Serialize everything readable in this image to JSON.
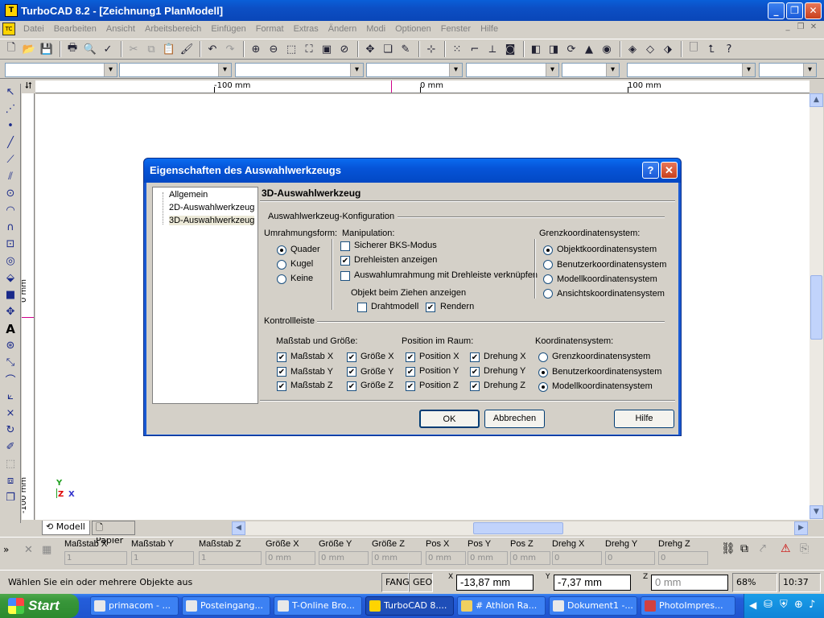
{
  "app": {
    "title": "TurboCAD 8.2 - [Zeichnung1 PlanModell]",
    "icon": "turbocad-icon"
  },
  "menu": [
    "Datei",
    "Bearbeiten",
    "Ansicht",
    "Arbeitsbereich",
    "Einfügen",
    "Format",
    "Extras",
    "Ändern",
    "Modi",
    "Optionen",
    "Fenster",
    "Hilfe"
  ],
  "rulers": {
    "top": [
      "-100 mm",
      "0 mm",
      "100 mm"
    ],
    "left": [
      "0 mm",
      "-100 mm"
    ]
  },
  "canvas_axis": {
    "y": "Y",
    "z": "Z",
    "x": "X"
  },
  "tabs": [
    "Modell",
    "Papier"
  ],
  "controlbar": {
    "fields": [
      {
        "label": "Maßstab X",
        "value": "1"
      },
      {
        "label": "Maßstab Y",
        "value": "1"
      },
      {
        "label": "Maßstab Z",
        "value": "1"
      },
      {
        "label": "Größe X",
        "value": "0 mm"
      },
      {
        "label": "Größe Y",
        "value": "0 mm"
      },
      {
        "label": "Größe Z",
        "value": "0 mm"
      },
      {
        "label": "Pos X",
        "value": "0 mm"
      },
      {
        "label": "Pos Y",
        "value": "0 mm"
      },
      {
        "label": "Pos Z",
        "value": "0 mm"
      },
      {
        "label": "Drehg X",
        "value": "0"
      },
      {
        "label": "Drehg Y",
        "value": "0"
      },
      {
        "label": "Drehg Z",
        "value": "0"
      }
    ]
  },
  "status": {
    "message": "Wählen Sie ein oder mehrere Objekte aus",
    "fang": "FANG",
    "geo": "GEO",
    "x_label": "X",
    "x": "-13,87 mm",
    "y_label": "Y",
    "y": "-7,37 mm",
    "z_label": "Z",
    "z": "0 mm",
    "zoom": "68%",
    "time": "10:37"
  },
  "taskbar": {
    "start": "Start",
    "tasks": [
      "primacom - ...",
      "Posteingang...",
      "T-Online Bro...",
      "TurboCAD 8....",
      "# Athlon Ra...",
      "Dokument1 -...",
      "PhotoImpres..."
    ]
  },
  "dialog": {
    "title": "Eigenschaften des Auswahlwerkzeugs",
    "tree": [
      "Allgemein",
      "2D-Auswahlwerkzeug",
      "3D-Auswahlwerkzeug"
    ],
    "header": "3D-Auswahlwerkzeug",
    "config_label": "Auswahlwerkzeug-Konfiguration",
    "umrahmung": {
      "label": "Umrahmungsform:",
      "options": [
        {
          "label": "Quader",
          "checked": true
        },
        {
          "label": "Kugel",
          "checked": false
        },
        {
          "label": "Keine",
          "checked": false
        }
      ]
    },
    "manipulation": {
      "label": "Manipulation:",
      "options": [
        {
          "label": "Sicherer BKS-Modus",
          "checked": false
        },
        {
          "label": "Drehleisten anzeigen",
          "checked": true
        },
        {
          "label": "Auswahlumrahmung mit Drehleiste verknüpfen",
          "checked": false
        }
      ],
      "drag_label": "Objekt beim Ziehen anzeigen",
      "drag_options": [
        {
          "label": "Drahtmodell",
          "checked": false
        },
        {
          "label": "Rendern",
          "checked": true
        }
      ]
    },
    "grenz": {
      "label": "Grenzkoordinatensystem:",
      "options": [
        {
          "label": "Objektkoordinatensystem",
          "checked": true
        },
        {
          "label": "Benutzerkoordinatensystem",
          "checked": false
        },
        {
          "label": "Modellkoordinatensystem",
          "checked": false
        },
        {
          "label": "Ansichtskoordinatensystem",
          "checked": false
        }
      ]
    },
    "kontroll_label": "Kontrollleiste",
    "massstab": {
      "label": "Maßstab und Größe:",
      "col1": [
        "Maßstab X",
        "Maßstab Y",
        "Maßstab Z"
      ],
      "col2": [
        "Größe X",
        "Größe Y",
        "Größe Z"
      ]
    },
    "position": {
      "label": "Position im Raum:",
      "col1": [
        "Position X",
        "Position Y",
        "Position Z"
      ],
      "col2": [
        "Drehung X",
        "Drehung Y",
        "Drehung Z"
      ]
    },
    "koord": {
      "label": "Koordinatensystem:",
      "options": [
        {
          "label": "Grenzkoordinatensystem",
          "checked": false
        },
        {
          "label": "Benutzerkoordinatensystem",
          "checked": true
        },
        {
          "label": "Modellkoordinatensystem",
          "checked": true
        }
      ]
    },
    "buttons": {
      "ok": "OK",
      "cancel": "Abbrechen",
      "help": "Hilfe"
    }
  }
}
